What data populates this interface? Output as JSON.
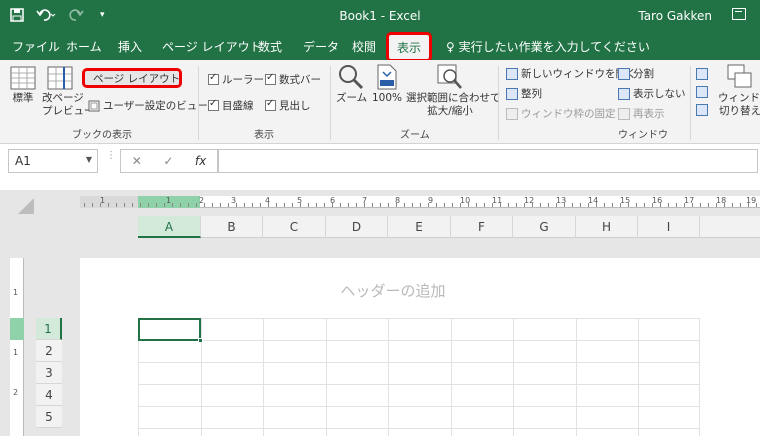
{
  "titlebar": {
    "title": "Book1 - Excel",
    "user": "Taro Gakken",
    "qat": {
      "save_icon": "save-icon",
      "undo_icon": "undo-icon",
      "redo_icon": "redo-icon",
      "customize_icon": "customize-qat-icon"
    }
  },
  "tabs": [
    {
      "label": "ファイル"
    },
    {
      "label": "ホーム"
    },
    {
      "label": "挿入"
    },
    {
      "label": "ページ レイアウト"
    },
    {
      "label": "数式"
    },
    {
      "label": "データ"
    },
    {
      "label": "校閲"
    },
    {
      "label": "表示"
    }
  ],
  "tell_me": "♀ 実行したい作業を入力してください",
  "ribbon": {
    "workbook_views": {
      "label": "ブックの表示",
      "normal": "標準",
      "page_break_preview": [
        "改ページ",
        "プレビュー"
      ],
      "page_layout": "ページ レイアウト",
      "custom_views": "ユーザー設定のビュー"
    },
    "show": {
      "label": "表示",
      "ruler": "ルーラー",
      "formula_bar": "数式バー",
      "gridlines": "目盛線",
      "headings": "見出し"
    },
    "zoom": {
      "label": "ズーム",
      "zoom": "ズーム",
      "zoom_100": "100%",
      "zoom_to_selection": [
        "選択範囲に合わせて",
        "拡大/縮小"
      ]
    },
    "window": {
      "label": "ウィンドウ",
      "new_window": "新しいウィンドウを開く",
      "arrange_all": "整列",
      "freeze_panes": "ウィンドウ枠の固定",
      "split": "分割",
      "hide": "表示しない",
      "unhide": "再表示",
      "switch_windows": [
        "ウィンドウ",
        "切り替え"
      ]
    }
  },
  "formula_bar": {
    "name_box": "A1",
    "cancel": "✕",
    "enter": "✓",
    "fx": "fx",
    "value": ""
  },
  "ruler": {
    "h_labels": [
      "1",
      "1",
      "2",
      "3",
      "4",
      "5",
      "6",
      "7",
      "8",
      "9",
      "10",
      "11",
      "12",
      "13",
      "14",
      "15",
      "16",
      "17",
      "18",
      "19"
    ],
    "v_labels": [
      "1",
      "1",
      "2"
    ]
  },
  "sheet": {
    "columns": [
      "A",
      "B",
      "C",
      "D",
      "E",
      "F",
      "G",
      "H",
      "I"
    ],
    "rows": [
      "1",
      "2",
      "3",
      "4",
      "5"
    ],
    "header_placeholder": "ヘッダーの追加",
    "selected_cell": "A1"
  },
  "colors": {
    "excel_green": "#217346",
    "highlight_red": "#ee0000",
    "active_header": "#d3e9da"
  }
}
